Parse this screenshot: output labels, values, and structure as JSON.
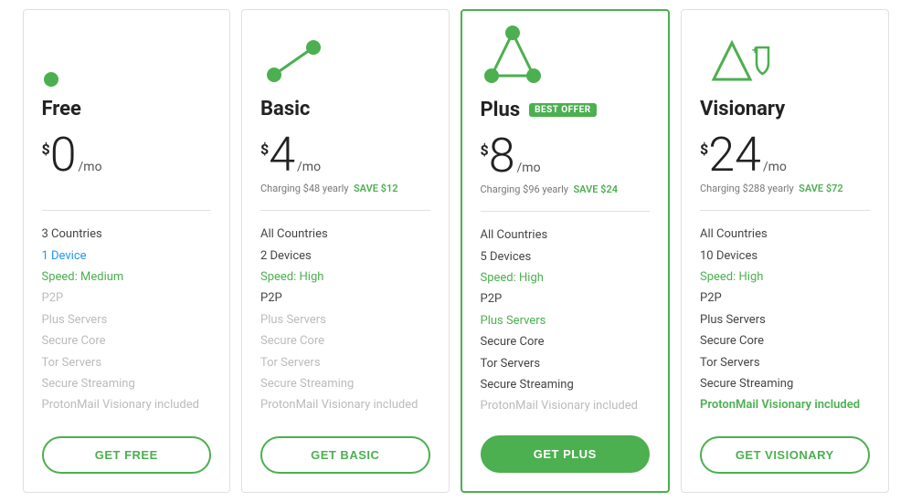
{
  "plans": [
    {
      "id": "free",
      "name": "Free",
      "price": "0",
      "period": "/mo",
      "billing": "",
      "save": "",
      "best_offer": false,
      "highlighted": false,
      "button_label": "GET FREE",
      "button_primary": false,
      "features": [
        {
          "text": "3 Countries",
          "style": "normal"
        },
        {
          "text": "1 Device",
          "style": "colored-blue"
        },
        {
          "text": "Speed: Medium",
          "style": "colored"
        },
        {
          "text": "P2P",
          "style": "disabled"
        },
        {
          "text": "Plus Servers",
          "style": "disabled"
        },
        {
          "text": "Secure Core",
          "style": "disabled"
        },
        {
          "text": "Tor Servers",
          "style": "disabled"
        },
        {
          "text": "Secure Streaming",
          "style": "disabled"
        },
        {
          "text": "ProtonMail Visionary included",
          "style": "disabled"
        }
      ]
    },
    {
      "id": "basic",
      "name": "Basic",
      "price": "4",
      "period": "/mo",
      "billing": "Charging $48 yearly",
      "save": "SAVE $12",
      "best_offer": false,
      "highlighted": false,
      "button_label": "GET BASIC",
      "button_primary": false,
      "features": [
        {
          "text": "All Countries",
          "style": "normal"
        },
        {
          "text": "2 Devices",
          "style": "normal"
        },
        {
          "text": "Speed: High",
          "style": "colored"
        },
        {
          "text": "P2P",
          "style": "normal"
        },
        {
          "text": "Plus Servers",
          "style": "disabled"
        },
        {
          "text": "Secure Core",
          "style": "disabled"
        },
        {
          "text": "Tor Servers",
          "style": "disabled"
        },
        {
          "text": "Secure Streaming",
          "style": "disabled"
        },
        {
          "text": "ProtonMail Visionary included",
          "style": "disabled"
        }
      ]
    },
    {
      "id": "plus",
      "name": "Plus",
      "price": "8",
      "period": "/mo",
      "billing": "Charging $96 yearly",
      "save": "SAVE $24",
      "best_offer": true,
      "highlighted": true,
      "button_label": "GET PLUS",
      "button_primary": true,
      "features": [
        {
          "text": "All Countries",
          "style": "normal"
        },
        {
          "text": "5 Devices",
          "style": "normal"
        },
        {
          "text": "Speed: High",
          "style": "colored"
        },
        {
          "text": "P2P",
          "style": "normal"
        },
        {
          "text": "Plus Servers",
          "style": "colored"
        },
        {
          "text": "Secure Core",
          "style": "normal"
        },
        {
          "text": "Tor Servers",
          "style": "normal"
        },
        {
          "text": "Secure Streaming",
          "style": "normal"
        },
        {
          "text": "ProtonMail Visionary included",
          "style": "disabled"
        }
      ]
    },
    {
      "id": "visionary",
      "name": "Visionary",
      "price": "24",
      "period": "/mo",
      "billing": "Charging $288 yearly",
      "save": "SAVE $72",
      "best_offer": false,
      "highlighted": false,
      "button_label": "GET VISIONARY",
      "button_primary": false,
      "features": [
        {
          "text": "All Countries",
          "style": "normal"
        },
        {
          "text": "10 Devices",
          "style": "normal"
        },
        {
          "text": "Speed: High",
          "style": "colored"
        },
        {
          "text": "P2P",
          "style": "normal"
        },
        {
          "text": "Plus Servers",
          "style": "normal"
        },
        {
          "text": "Secure Core",
          "style": "normal"
        },
        {
          "text": "Tor Servers",
          "style": "normal"
        },
        {
          "text": "Secure Streaming",
          "style": "normal"
        },
        {
          "text": "ProtonMail Visionary included",
          "style": "colored"
        }
      ]
    }
  ],
  "accent_color": "#4caf50"
}
